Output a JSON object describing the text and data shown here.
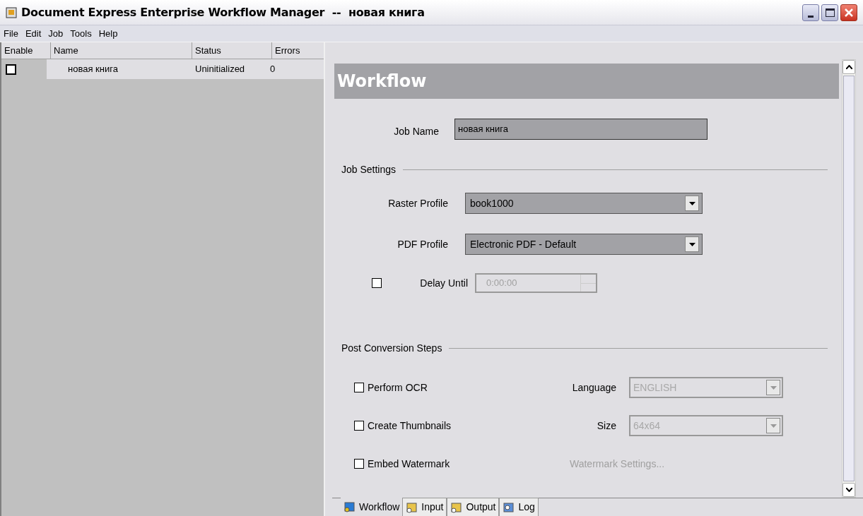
{
  "window": {
    "title": "Document Express Enterprise Workflow Manager  --  новая книга"
  },
  "menu": [
    "File",
    "Edit",
    "Job",
    "Tools",
    "Help"
  ],
  "jobs": {
    "columns": [
      "Enable",
      "Name",
      "Status",
      "Errors"
    ],
    "rows": [
      {
        "enabled": false,
        "selected": true,
        "name": "новая книга",
        "status": "Uninitialized",
        "errors": "0"
      }
    ]
  },
  "panel": {
    "heading": "Workflow",
    "job_name": {
      "label": "Job Name",
      "value": "новая книга"
    },
    "job_settings": {
      "title": "Job Settings",
      "raster_profile": {
        "label": "Raster Profile",
        "value": "book1000"
      },
      "pdf_profile": {
        "label": "PDF Profile",
        "value": "Electronic PDF - Default"
      },
      "delay": {
        "label": "Delay Until",
        "checked": false,
        "value": "0:00:00",
        "disabled": true
      }
    },
    "post_steps": {
      "title": "Post Conversion Steps",
      "rows": [
        {
          "label": "Perform OCR",
          "checked": false,
          "kind": "select",
          "option_label": "Language",
          "option_value": "ENGLISH",
          "disabled": true
        },
        {
          "label": "Create Thumbnails",
          "checked": false,
          "kind": "select",
          "option_label": "Size",
          "option_value": "64x64",
          "disabled": true
        },
        {
          "label": "Embed Watermark",
          "checked": false,
          "kind": "link",
          "option_label": "Watermark Settings...",
          "disabled": true
        }
      ]
    }
  },
  "tabs": [
    {
      "label": "Workflow",
      "selected": true
    },
    {
      "label": "Input",
      "selected": false
    },
    {
      "label": "Output",
      "selected": false
    },
    {
      "label": "Log",
      "selected": false
    }
  ]
}
